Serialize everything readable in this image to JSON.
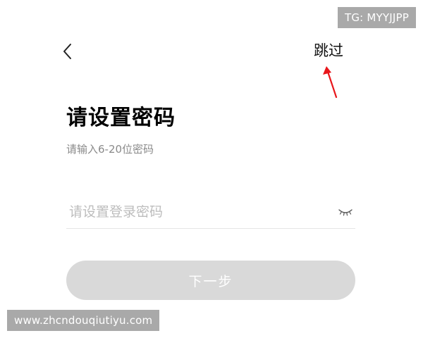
{
  "overlay": {
    "tg_badge": "TG: MYYJJPP",
    "watermark": "www.zhcndouqiutiyu.com"
  },
  "nav": {
    "back_icon": "chevron-left-icon",
    "skip_label": "跳过"
  },
  "annotation": {
    "arrow_color": "#e8161b"
  },
  "content": {
    "title": "请设置密码",
    "subtitle": "请输入6-20位密码",
    "password_placeholder": "请设置登录密码",
    "password_value": "",
    "toggle_icon": "eye-closed-icon",
    "next_label": "下一步"
  },
  "colors": {
    "button_disabled": "#d9d9d9",
    "subtitle": "#8a8a8a",
    "placeholder": "#bdbdbd"
  }
}
